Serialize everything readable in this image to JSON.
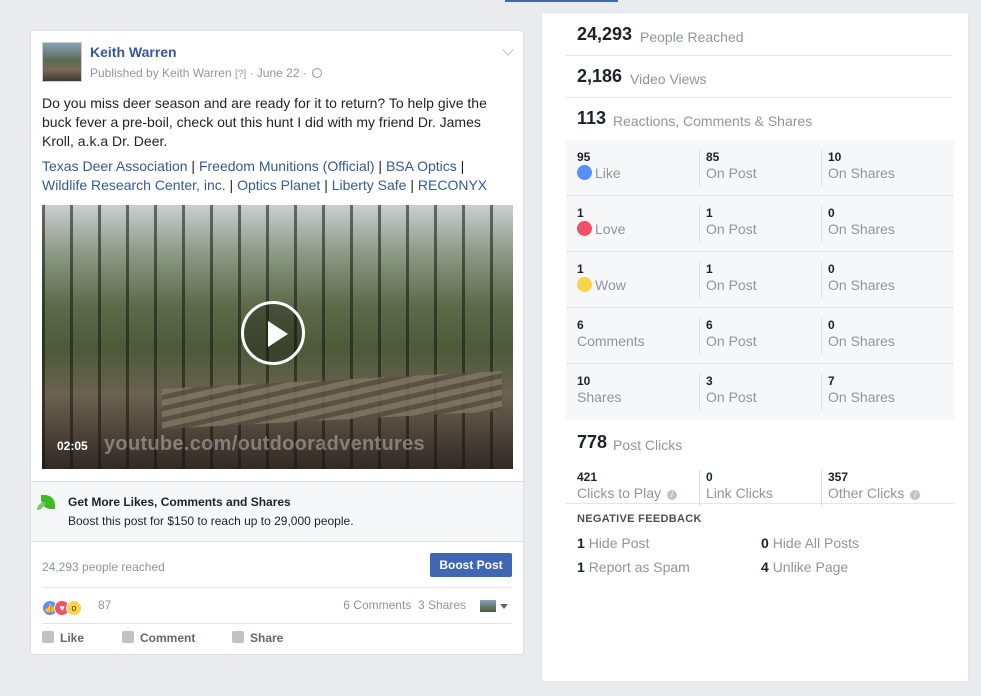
{
  "post": {
    "author": "Keith Warren",
    "published_by": "Published by Keith Warren",
    "help_marker": "[?]",
    "date": "June 22",
    "text": "Do you miss deer season and are ready for it to return? To help give the buck fever a pre-boil, check out this hunt I did with my friend Dr. James Kroll, a.k.a Dr. Deer.",
    "tags": [
      "Texas Deer Association",
      "Freedom Munitions (Official)",
      "BSA Optics",
      "Wildlife Research Center, inc.",
      "Optics Planet",
      "Liberty Safe",
      "RECONYX"
    ],
    "video": {
      "duration": "02:05",
      "watermark": "youtube.com/outdooradventures"
    },
    "boost": {
      "title": "Get More Likes, Comments and Shares",
      "subtitle": "Boost this post for $150 to reach up to 29,000 people.",
      "reach_text": "24,293 people reached",
      "button_label": "Boost Post"
    },
    "reactions_count": "87",
    "comments_label": "6 Comments",
    "shares_label": "3 Shares",
    "actions": {
      "like": "Like",
      "comment": "Comment",
      "share": "Share"
    }
  },
  "insights": {
    "people_reached": {
      "value": "24,293",
      "label": "People Reached"
    },
    "video_views": {
      "value": "2,186",
      "label": "Video Views"
    },
    "engagement": {
      "value": "113",
      "label": "Reactions, Comments & Shares"
    },
    "rows": [
      {
        "total": "95",
        "label": "Like",
        "on_post": "85",
        "on_post_label": "On Post",
        "on_shares": "10",
        "on_shares_label": "On Shares"
      },
      {
        "total": "1",
        "label": "Love",
        "on_post": "1",
        "on_post_label": "On Post",
        "on_shares": "0",
        "on_shares_label": "On Shares"
      },
      {
        "total": "1",
        "label": "Wow",
        "on_post": "1",
        "on_post_label": "On Post",
        "on_shares": "0",
        "on_shares_label": "On Shares"
      },
      {
        "total": "6",
        "label": "Comments",
        "on_post": "6",
        "on_post_label": "On Post",
        "on_shares": "0",
        "on_shares_label": "On Shares"
      },
      {
        "total": "10",
        "label": "Shares",
        "on_post": "3",
        "on_post_label": "On Post",
        "on_shares": "7",
        "on_shares_label": "On Shares"
      }
    ],
    "post_clicks": {
      "value": "778",
      "label": "Post Clicks"
    },
    "clicks": [
      {
        "value": "421",
        "label": "Clicks to Play"
      },
      {
        "value": "0",
        "label": "Link Clicks"
      },
      {
        "value": "357",
        "label": "Other Clicks"
      }
    ],
    "negative_title": "NEGATIVE FEEDBACK",
    "negative": [
      {
        "value": "1",
        "label": "Hide Post"
      },
      {
        "value": "0",
        "label": "Hide All Posts"
      },
      {
        "value": "1",
        "label": "Report as Spam"
      },
      {
        "value": "4",
        "label": "Unlike Page"
      }
    ]
  }
}
